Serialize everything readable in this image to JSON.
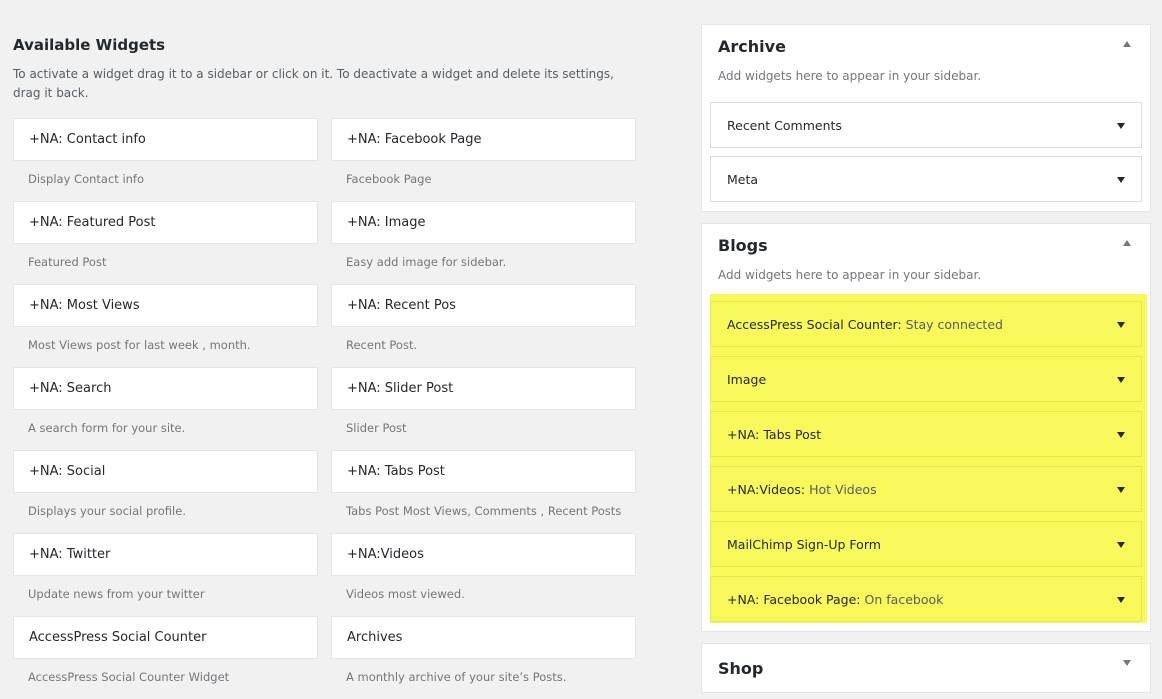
{
  "available": {
    "title": "Available Widgets",
    "description": "To activate a widget drag it to a sidebar or click on it. To deactivate a widget and delete its settings, drag it back.",
    "widgets": [
      {
        "name": "+NA: Contact info",
        "desc": "Display Contact info"
      },
      {
        "name": "+NA: Facebook Page",
        "desc": "Facebook Page"
      },
      {
        "name": "+NA: Featured Post",
        "desc": "Featured Post"
      },
      {
        "name": "+NA: Image",
        "desc": "Easy add image for sidebar."
      },
      {
        "name": "+NA: Most Views",
        "desc": "Most Views post for last week , month."
      },
      {
        "name": "+NA: Recent Pos",
        "desc": "Recent Post."
      },
      {
        "name": "+NA: Search",
        "desc": "A search form for your site."
      },
      {
        "name": "+NA: Slider Post",
        "desc": "Slider Post"
      },
      {
        "name": "+NA: Social",
        "desc": "Displays your social profile."
      },
      {
        "name": "+NA: Tabs Post",
        "desc": "Tabs Post Most Views, Comments , Recent Posts"
      },
      {
        "name": "+NA: Twitter",
        "desc": "Update news from your twitter"
      },
      {
        "name": "+NA:Videos",
        "desc": "Videos most viewed."
      },
      {
        "name": "AccessPress Social Counter",
        "desc": "AccessPress Social Counter Widget"
      },
      {
        "name": "Archives",
        "desc": "A monthly archive of your site’s Posts."
      }
    ]
  },
  "sidebars": [
    {
      "name": "Archive",
      "description": "Add widgets here to appear in your sidebar.",
      "expanded": true,
      "widgets": [
        {
          "title": "Recent Comments",
          "subtitle": ""
        },
        {
          "title": "Meta",
          "subtitle": ""
        }
      ]
    },
    {
      "name": "Blogs",
      "description": "Add widgets here to appear in your sidebar.",
      "expanded": true,
      "highlight_color": "#f7f958",
      "widgets": [
        {
          "title": "AccessPress Social Counter:",
          "subtitle": "Stay connected"
        },
        {
          "title": "Image",
          "subtitle": ""
        },
        {
          "title": "+NA: Tabs Post",
          "subtitle": ""
        },
        {
          "title": "+NA:Videos:",
          "subtitle": "Hot Videos"
        },
        {
          "title": "MailChimp Sign-Up Form",
          "subtitle": ""
        },
        {
          "title": "+NA: Facebook Page:",
          "subtitle": "On facebook"
        }
      ]
    },
    {
      "name": "Shop",
      "expanded": false
    }
  ]
}
